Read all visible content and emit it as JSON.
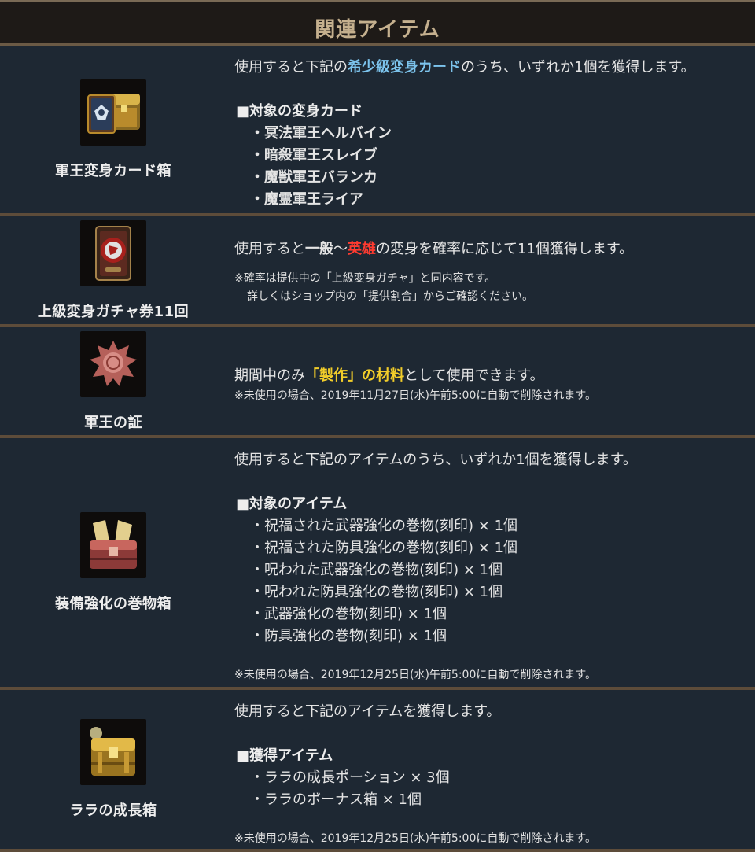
{
  "header": {
    "title": "関連アイテム"
  },
  "items": [
    {
      "name": "軍王変身カード箱",
      "icon": "card-chest-icon",
      "desc": {
        "pre": "使用すると下記の",
        "highlight": "希少級変身カード",
        "post": "のうち、いずれか1個を獲得します。"
      },
      "list_head": "■対象の変身カード",
      "list": [
        "・冥法軍王ヘルバイン",
        "・暗殺軍王スレイブ",
        "・魔獣軍王バランカ",
        "・魔霊軍王ライア"
      ]
    },
    {
      "name": "上級変身ガチャ券11回",
      "icon": "gacha-ticket-icon",
      "desc": {
        "pre": "使用すると",
        "bold": "一般",
        "mid": "～",
        "highlight": "英雄",
        "post": "の変身を確率に応じて11個獲得します。"
      },
      "notes": [
        "※確率は提供中の「上級変身ガチャ」と同内容です。",
        "詳しくはショップ内の「提供割合」からご確認ください。"
      ]
    },
    {
      "name": "軍王の証",
      "icon": "seal-emblem-icon",
      "desc": {
        "pre": "期間中のみ",
        "highlight": "「製作」の材料",
        "post": "として使用できます。"
      },
      "notes": [
        "※未使用の場合、2019年11月27日(水)午前5:00に自動で削除されます。"
      ]
    },
    {
      "name": "装備強化の巻物箱",
      "icon": "scroll-chest-icon",
      "desc": {
        "text": "使用すると下記のアイテムのうち、いずれか1個を獲得します。"
      },
      "list_head": "■対象のアイテム",
      "list": [
        "・祝福された武器強化の巻物(刻印) × 1個",
        "・祝福された防具強化の巻物(刻印) × 1個",
        "・呪われた武器強化の巻物(刻印) × 1個",
        "・呪われた防具強化の巻物(刻印) × 1個",
        "・武器強化の巻物(刻印) × 1個",
        "・防具強化の巻物(刻印) × 1個"
      ],
      "notes": [
        "※未使用の場合、2019年12月25日(水)午前5:00に自動で削除されます。"
      ]
    },
    {
      "name": "ララの成長箱",
      "icon": "golden-chest-icon",
      "desc": {
        "text": "使用すると下記のアイテムを獲得します。"
      },
      "list_head": "■獲得アイテム",
      "list": [
        "・ララの成長ポーション × 3個",
        "・ララのボーナス箱 × 1個"
      ],
      "notes": [
        "※未使用の場合、2019年12月25日(水)午前5:00に自動で削除されます。"
      ]
    }
  ]
}
